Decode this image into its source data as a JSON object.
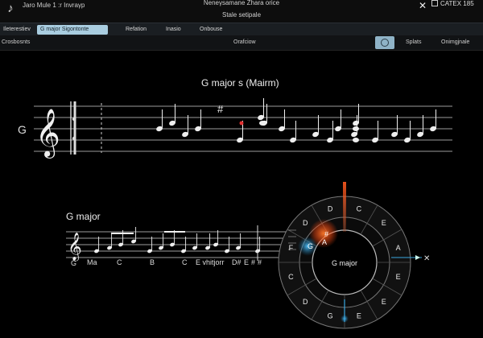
{
  "titlebar": {
    "app_name": "Jaro  Mule  1 :r  Invraγp",
    "doc_title_line1": "Neneγsamane  Zhara  orice",
    "doc_title_line2": "Stale setipale",
    "close_glyph": "✕",
    "corner_label": "CATEX 185"
  },
  "tabs": [
    {
      "label": "Ileterestiev",
      "active": false
    },
    {
      "label": "G major Sigontonte",
      "active": true
    },
    {
      "label": "Refation",
      "active": false
    },
    {
      "label": "Inasio",
      "active": false
    },
    {
      "label": "Onbouse",
      "active": false
    }
  ],
  "subbar": {
    "left_label": "Crosbosnts",
    "center_label": "Orafciow",
    "icon": "settings-ring-icon",
    "right1_label": "Splats",
    "right2_label": "Onimgjnale"
  },
  "main_staff": {
    "title": "G major  s  (Mairm)",
    "side_label": "G",
    "clef": "𝄞",
    "sharp": "#"
  },
  "lower_staff": {
    "title": "G major",
    "clef": "𝄞",
    "labels": [
      "G",
      "Ma",
      "C",
      "B",
      "C",
      "E vhitjorr",
      "D#",
      "E",
      "#",
      "#"
    ]
  },
  "circle": {
    "center_label": "G major",
    "outer_labels": [
      "C",
      "E",
      "A",
      "E",
      "E",
      "E",
      "G",
      "D",
      "C",
      "F",
      "D",
      "D"
    ],
    "inner_labels": [
      "#",
      "A",
      "G"
    ],
    "highlight_color": "#ff5a1f",
    "marker_color": "#3aa7e0",
    "pointer_glyph": "✕"
  }
}
